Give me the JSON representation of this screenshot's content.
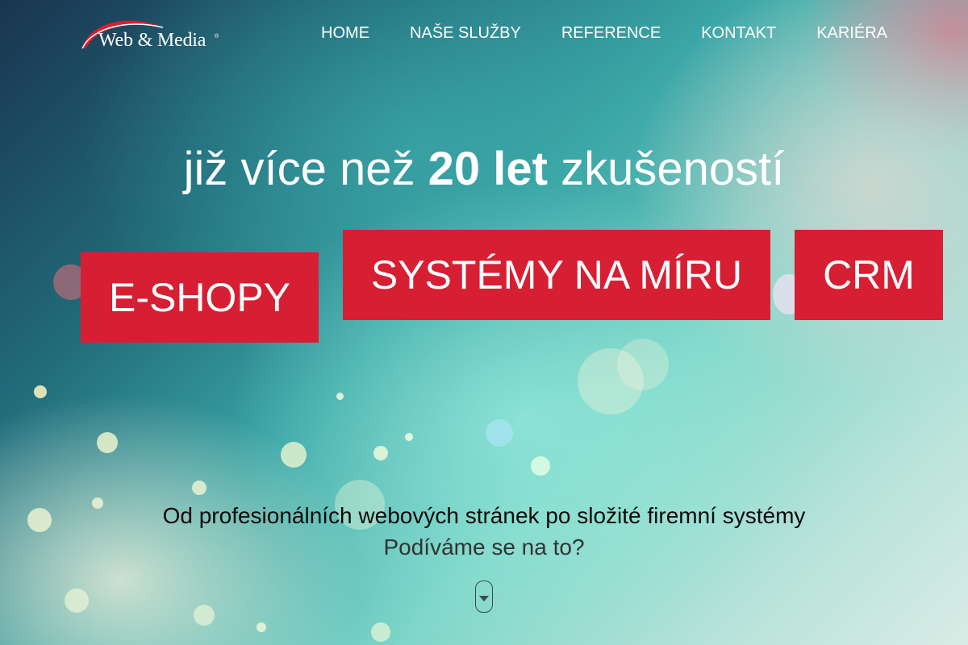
{
  "logo": {
    "text": "Web & Media",
    "registered": "®"
  },
  "nav": {
    "items": [
      {
        "label": "HOME"
      },
      {
        "label": "NAŠE SLUŽBY"
      },
      {
        "label": "REFERENCE"
      },
      {
        "label": "KONTAKT"
      },
      {
        "label": "KARIÉRA"
      }
    ]
  },
  "hero": {
    "headline_pre": "již více než",
    "headline_strong": "20 let",
    "headline_post": "zkušeností",
    "buttons": [
      {
        "label": "E-SHOPY"
      },
      {
        "label": "SYSTÉMY NA MÍRU"
      },
      {
        "label": "CRM"
      }
    ],
    "tagline": "Od profesionálních webových stránek po složité firemní systémy",
    "subtagline": "Podíváme se na to?",
    "scroll_icon": "chevron-down-icon"
  },
  "colors": {
    "accent_red": "#d61f33",
    "text_white": "#ffffff",
    "logo_arc": "#d61f33"
  }
}
